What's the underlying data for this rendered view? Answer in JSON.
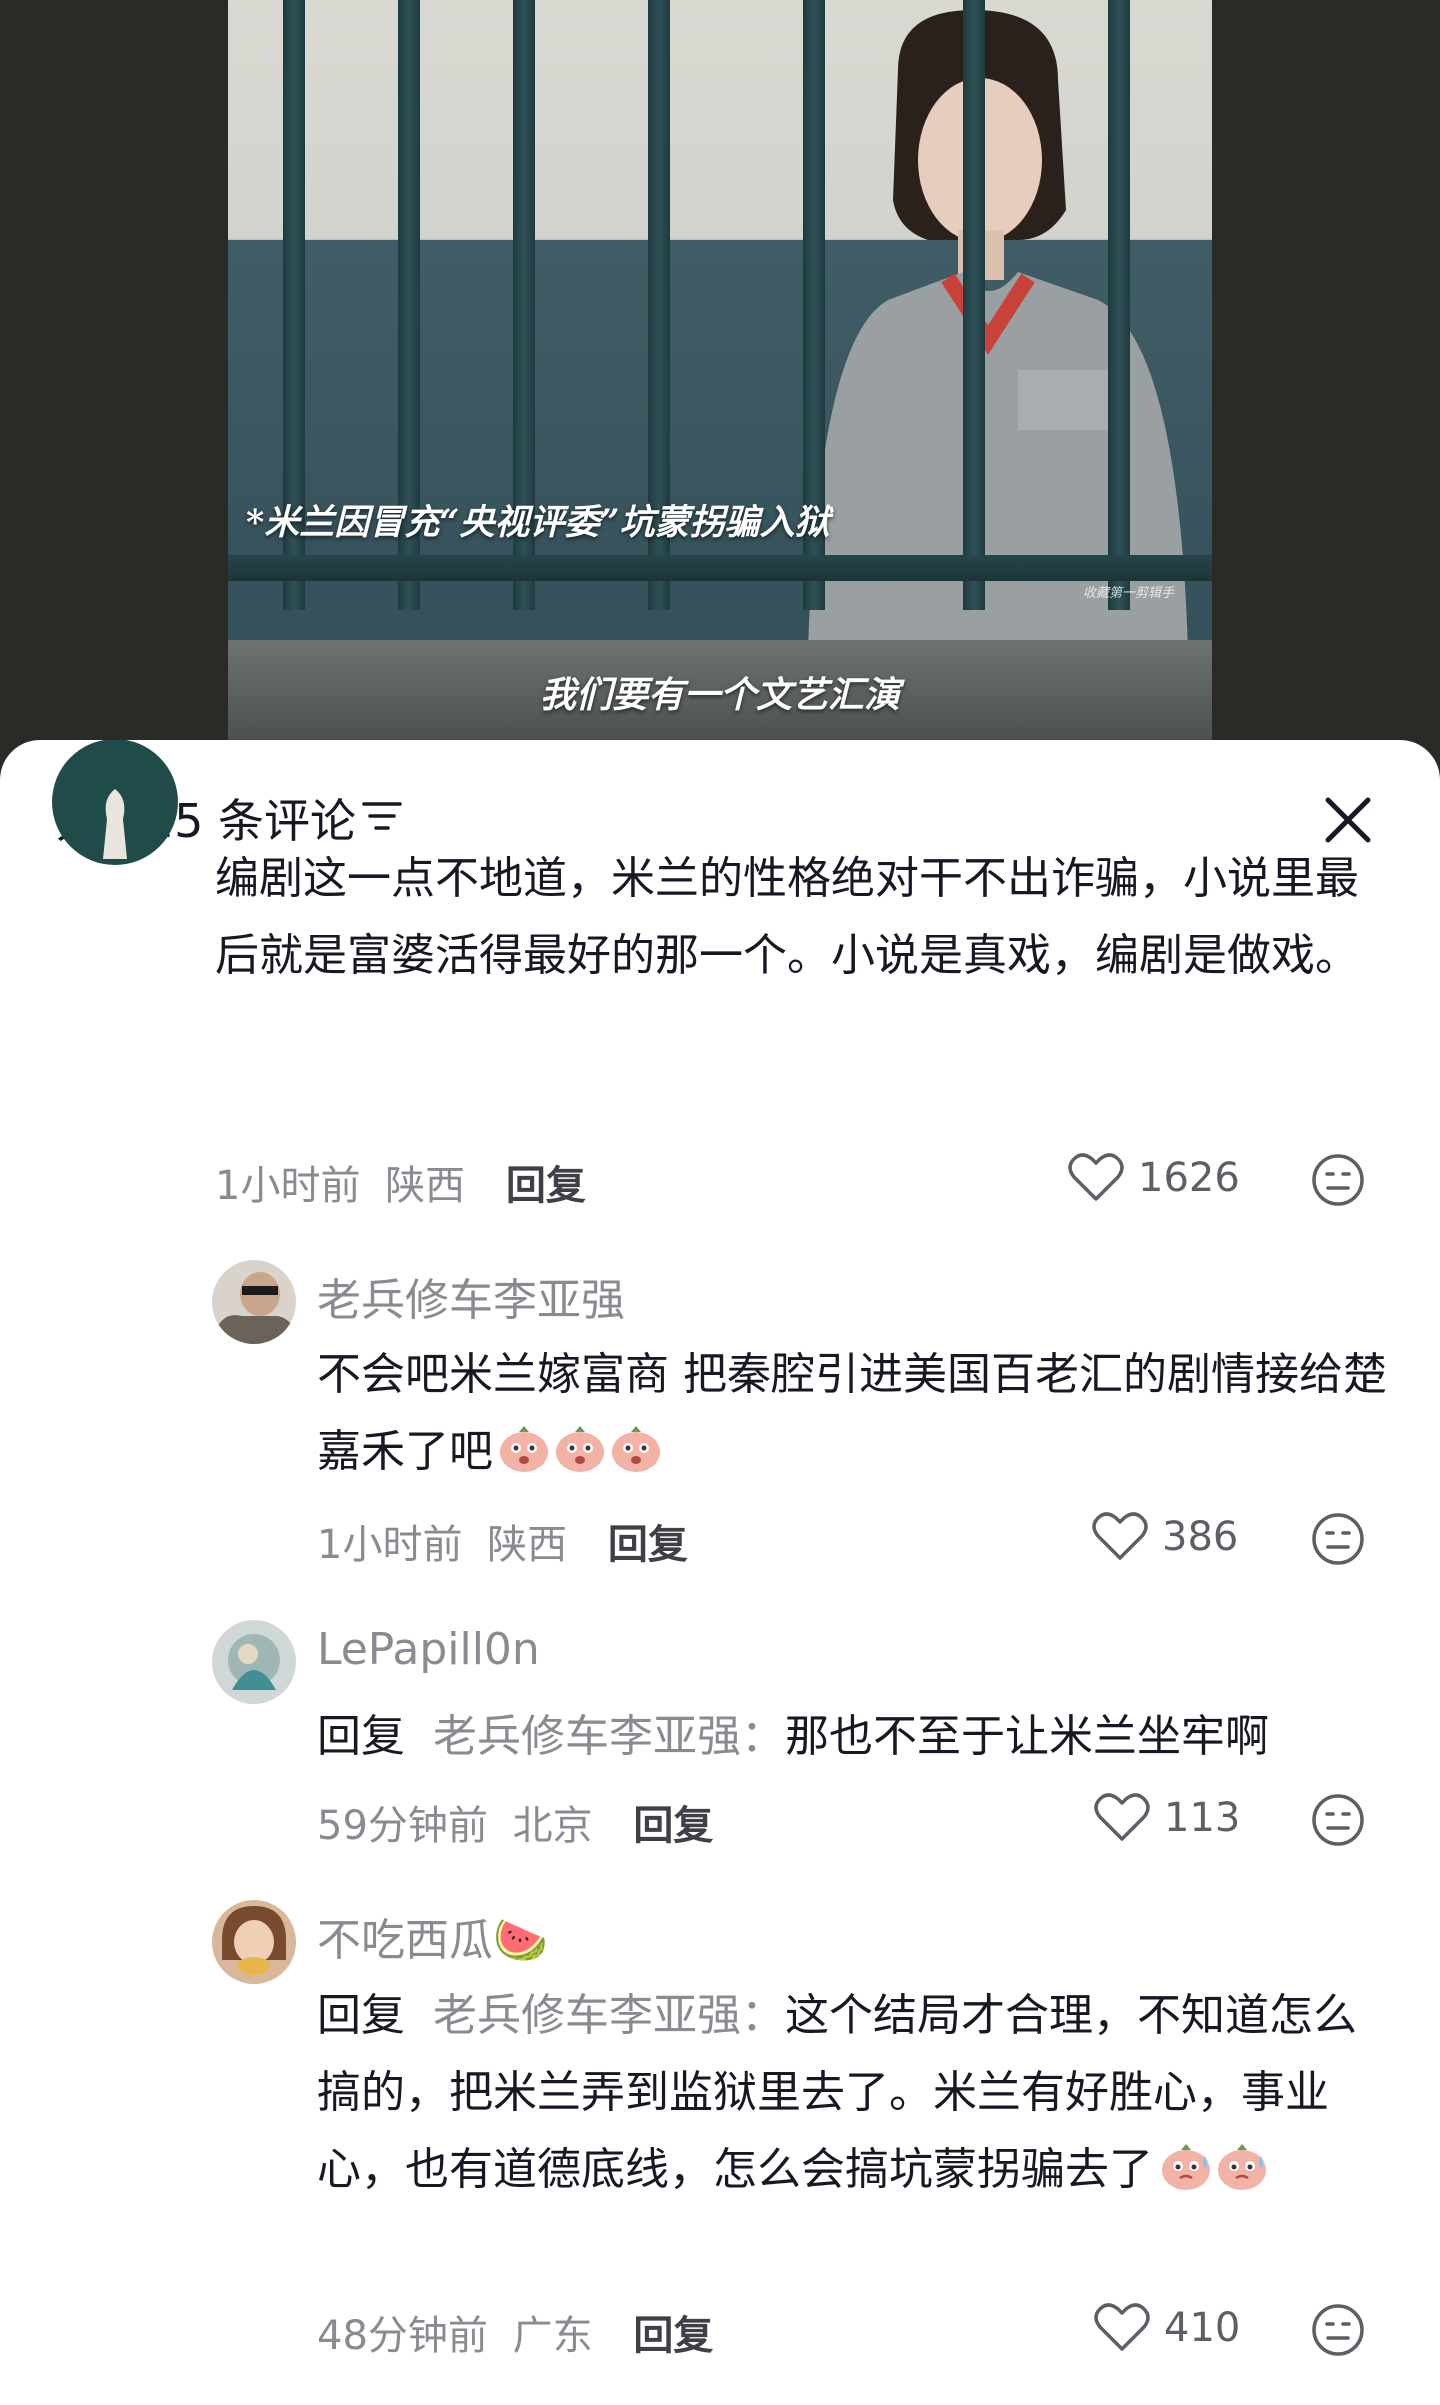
{
  "video": {
    "caption_top": "*米兰因冒充“央视评委”坑蒙拐骗入狱",
    "watermark": "收藏第一剪辑手",
    "caption_bottom": "我们要有一个文艺汇演"
  },
  "comments_sheet": {
    "count_label": "共 125 条评论",
    "reply_label": "回复"
  },
  "comments": [
    {
      "text": "编剧这一点不地道，米兰的性格绝对干不出诈骗，小说里最后就是富婆活得最好的那一个。小说是真戏，编剧是做戏。",
      "time": "1小时前",
      "location": "陕西",
      "likes": "1626"
    }
  ],
  "replies": [
    {
      "author": "老兵修车李亚强",
      "text": "不会吧米兰嫁富商 把秦腔引进美国百老汇的剧情接给楚嘉禾了吧",
      "time": "1小时前",
      "location": "陕西",
      "likes": "386"
    },
    {
      "author": "LePapill0n",
      "prefix": "回复",
      "target": "老兵修车李亚强",
      "text": "那也不至于让米兰坐牢啊",
      "time": "59分钟前",
      "location": "北京",
      "likes": "113"
    },
    {
      "author": "不吃西瓜🍉",
      "prefix": "回复",
      "target": "老兵修车李亚强",
      "text": "这个结局才合理，不知道怎么搞的，把米兰弄到监狱里去了。米兰有好胜心，事业心，也有道德底线，怎么会搞坑蒙拐骗去了",
      "time": "48分钟前",
      "location": "广东",
      "likes": "410"
    }
  ],
  "icons": {
    "filter": "filter-icon",
    "close": "close-icon",
    "like": "heart-outline-icon",
    "emoji": "emoji-face-icon"
  }
}
